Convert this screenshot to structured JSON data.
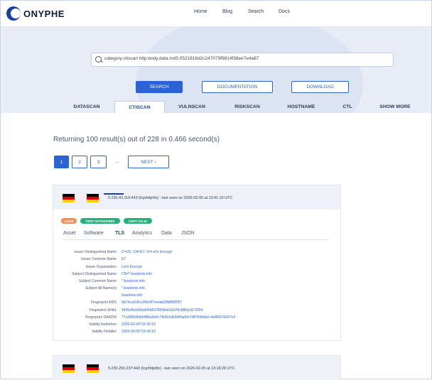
{
  "brand": {
    "name": "ONYPHE"
  },
  "nav": {
    "items": [
      "Home",
      "Blog",
      "Search",
      "Docs"
    ]
  },
  "search": {
    "query": "category:ctiscan http.body.data.md5:0521816d2c247079f9814f38ee7e4a87"
  },
  "buttons": {
    "search": "SEARCH",
    "documentation": "DOCUMENTATION",
    "download": "DOWNLOAD"
  },
  "tabs": [
    "DATASCAN",
    "CTISCAN",
    "VULNSCAN",
    "RISKSCAN",
    "HOSTNAME",
    "CTL",
    "SHOW MORE"
  ],
  "active_tab": "CTISCAN",
  "results": {
    "summary": "Returning 100 result(s) out of 228 in 0.466 second(s)"
  },
  "pagination": {
    "pages": [
      "1",
      "2",
      "3"
    ],
    "active": "1",
    "ellipsis": "...",
    "next": "NEXT ›"
  },
  "colors": {
    "accent": "#2a63d4",
    "badge_login": "#f28c5b",
    "badge_cert": "#22b17a",
    "hero_bg": "#e7ecf7"
  },
  "result_cards": [
    {
      "title": "5.230.43.119:443 (tcp/http/tls) - last seen on 2026-02-05 at 13:41:10 UTC",
      "badges": [
        "LOGIN",
        "CERT::NOTEXPIRED",
        "CERT::VALID"
      ],
      "subtabs": [
        "Asset",
        "Software",
        "TLS",
        "Analytics",
        "Data",
        "JSON"
      ],
      "active_subtab": "TLS",
      "fields": [
        {
          "label": "Issuer Distinguished Name",
          "value": "C=US, CN=E7, O=Let's Encrypt"
        },
        {
          "label": "Issuer Common Name",
          "value": "E7"
        },
        {
          "label": "Issuer Organization",
          "value": "Let's Encrypt"
        },
        {
          "label": "Subject Distinguished Name",
          "value": "CN=*.braxlenis.info"
        },
        {
          "label": "Subject Common Name",
          "value": "*.braxlenis.info"
        },
        {
          "label": "Subject Alt Name(s)",
          "value": "*.braxlenis.info"
        },
        {
          "label": "",
          "value": "braxlenis.info"
        },
        {
          "label": "Fingerprint MD5",
          "value": "6b74ccb18ce39e047eeda02fbf89f2f57"
        },
        {
          "label": "Fingerprint SHA1",
          "value": "9436cf6c9d2ed05d637820bdc1b578c88fa1d17f154"
        },
        {
          "label": "Fingerprint SHA256",
          "value": "77cd9818b9e0f86a0e5c7fb2b2db3d65af0e7d870db8a1c4af9067b397e2"
        },
        {
          "label": "Validity Notbefore",
          "value": "2026-02-04T16:42:52"
        },
        {
          "label": "Validity Notafter",
          "value": "2026-05-05T16:42:52"
        }
      ]
    },
    {
      "title": "5.230.250.237:443 (tcp/http/tls) - last seen on 2026-02-05 at 13:18:28 UTC"
    }
  ]
}
